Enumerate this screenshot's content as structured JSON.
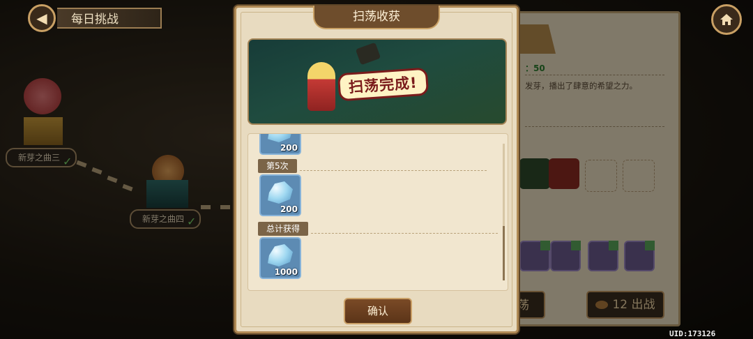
{
  "header": {
    "back_icon": "back-arrow-icon",
    "title": "每日挑战",
    "home_icon": "home-icon"
  },
  "map": {
    "nodes": [
      {
        "label": "新芽之曲三",
        "cleared": true
      },
      {
        "label": "新芽之曲四",
        "cleared": true
      }
    ]
  },
  "side_panel": {
    "stamina_text": "：50",
    "description": "发芽，播出了肆意的希望之力。",
    "sweep_label": "荡",
    "battle_label": "12 出战"
  },
  "uid": "UID:173126",
  "modal": {
    "title": "扫荡收获",
    "banner_text": "扫荡完成!",
    "rows": [
      {
        "type": "item",
        "count": "200"
      },
      {
        "type": "round",
        "label": "第5次"
      },
      {
        "type": "item",
        "count": "200"
      },
      {
        "type": "round",
        "label": "总计获得"
      },
      {
        "type": "item",
        "count": "1000"
      }
    ],
    "confirm_label": "确认"
  },
  "colors": {
    "accent_gold": "#c9a064",
    "panel_bg": "#e8dbc0",
    "item_blue": "#5d8bb3",
    "button_brown": "#6e4d2c"
  }
}
